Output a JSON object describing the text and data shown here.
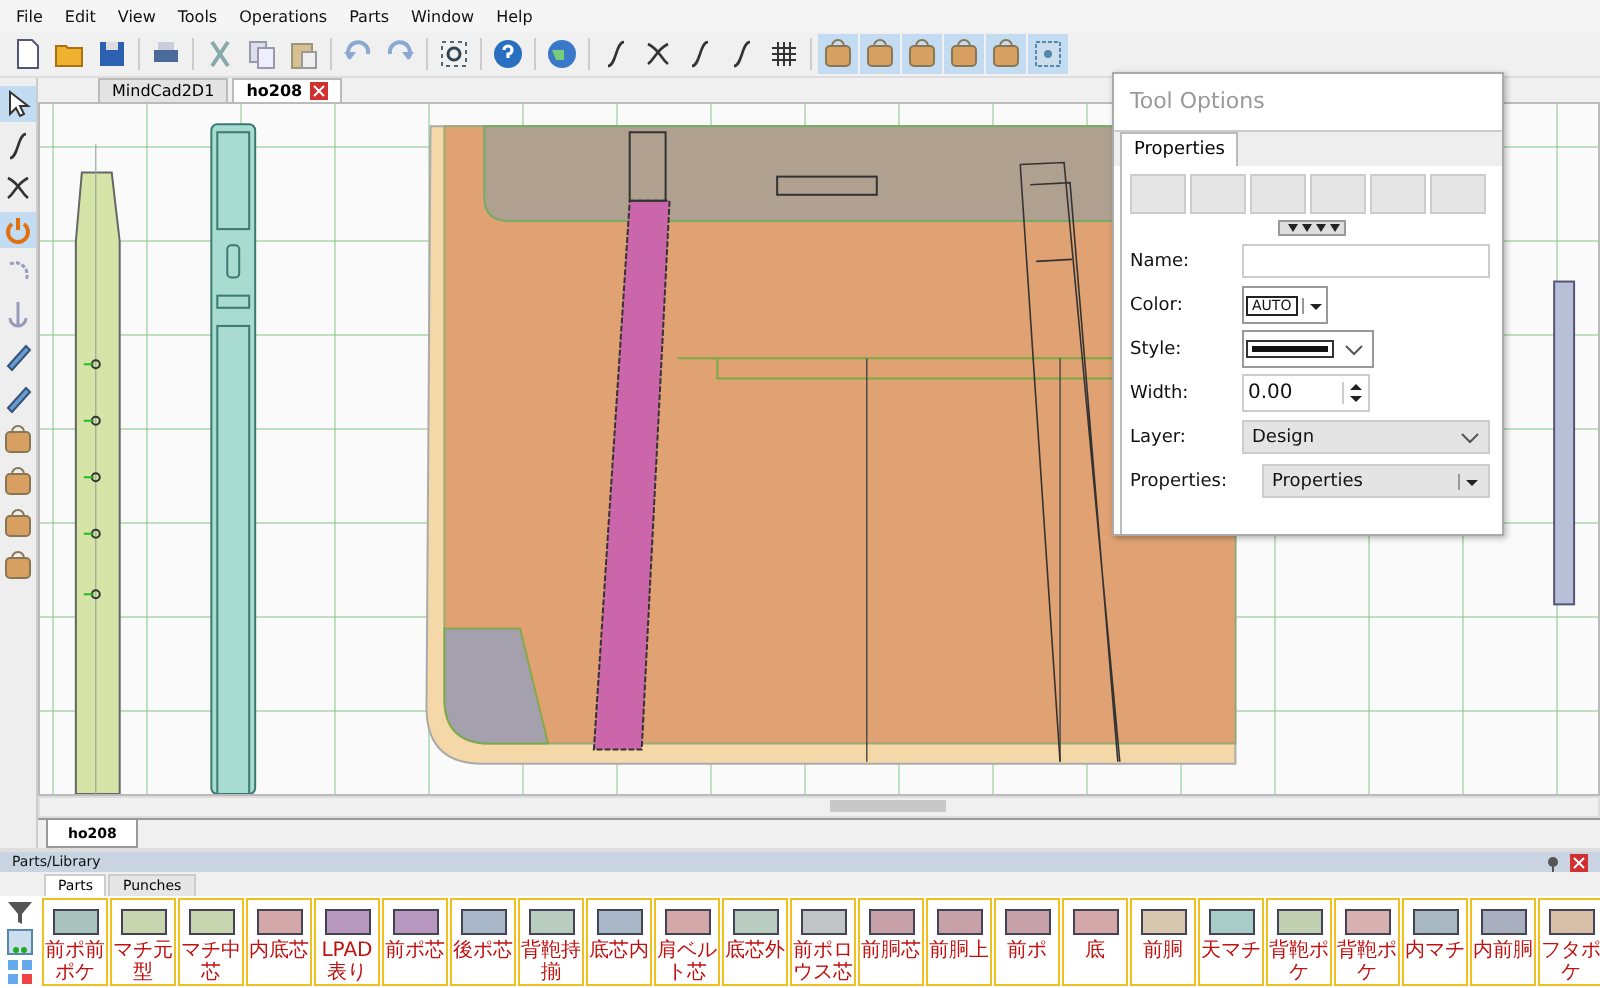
{
  "menu": [
    "File",
    "Edit",
    "View",
    "Tools",
    "Operations",
    "Parts",
    "Window",
    "Help"
  ],
  "left_tools": [
    {
      "selected": true
    },
    {
      "selected": false
    },
    {
      "selected": false
    },
    {
      "selected": true
    },
    {
      "selected": false
    },
    {
      "selected": false
    },
    {
      "selected": false
    },
    {
      "selected": false
    },
    {
      "selected": false
    },
    {
      "selected": false
    },
    {
      "selected": false
    },
    {
      "selected": false
    }
  ],
  "document_tabs": [
    {
      "label": "MindCad2D1",
      "selected": false,
      "closable": false
    },
    {
      "label": "ho208",
      "selected": true,
      "closable": true
    }
  ],
  "sheet_tabs": [
    {
      "label": "ho208",
      "selected": true
    }
  ],
  "tool_options": {
    "title": "Tool Options",
    "tabs": [
      {
        "label": "Properties",
        "selected": true
      }
    ],
    "name": {
      "label": "Name:"
    },
    "color": {
      "label": "Color:",
      "value": "AUTO"
    },
    "style": {
      "label": "Style:"
    },
    "width": {
      "label": "Width:",
      "value": "0.00"
    },
    "layer": {
      "label": "Layer:",
      "value": "Design"
    },
    "properties": {
      "label": "Properties:",
      "value": "Properties"
    }
  },
  "library": {
    "title": "Parts/Library",
    "tabs": [
      {
        "label": "Parts",
        "selected": true
      },
      {
        "label": "Punches",
        "selected": false
      }
    ],
    "parts": [
      {
        "label": "前ポ前ポケ",
        "color": "#a9c4bd"
      },
      {
        "label": "マチ元型",
        "color": "#c8d6b0"
      },
      {
        "label": "マチ中芯",
        "color": "#c8d6b0"
      },
      {
        "label": "内底芯",
        "color": "#d4a8a8"
      },
      {
        "label": "LPAD 表り",
        "color": "#b898c0"
      },
      {
        "label": "前ポ芯",
        "color": "#b898c0"
      },
      {
        "label": "後ポ芯",
        "color": "#a8b8c8"
      },
      {
        "label": "背鞄持揃",
        "color": "#b8ccc0"
      },
      {
        "label": "底芯内",
        "color": "#a8b8c8"
      },
      {
        "label": "肩ベルト芯",
        "color": "#d4a8a8"
      },
      {
        "label": "底芯外",
        "color": "#b8ccc0"
      },
      {
        "label": "前ポロウス芯",
        "color": "#c0c4c4"
      },
      {
        "label": "前胴芯",
        "color": "#c8a0a8"
      },
      {
        "label": "前胴上",
        "color": "#c8a0a8"
      },
      {
        "label": "前ポ",
        "color": "#c8a0a8"
      },
      {
        "label": "底",
        "color": "#d4a8a8"
      },
      {
        "label": "前胴",
        "color": "#d8c8b0"
      },
      {
        "label": "天マチ",
        "color": "#a8ccc8"
      },
      {
        "label": "背鞄ポケ",
        "color": "#c0d0b0"
      },
      {
        "label": "背鞄ポケ",
        "color": "#d8b0b0"
      },
      {
        "label": "内マチ",
        "color": "#a8b8c0"
      },
      {
        "label": "内前胴",
        "color": "#a8b0c0"
      },
      {
        "label": "フタポケ",
        "color": "#d8c0a8"
      }
    ]
  }
}
